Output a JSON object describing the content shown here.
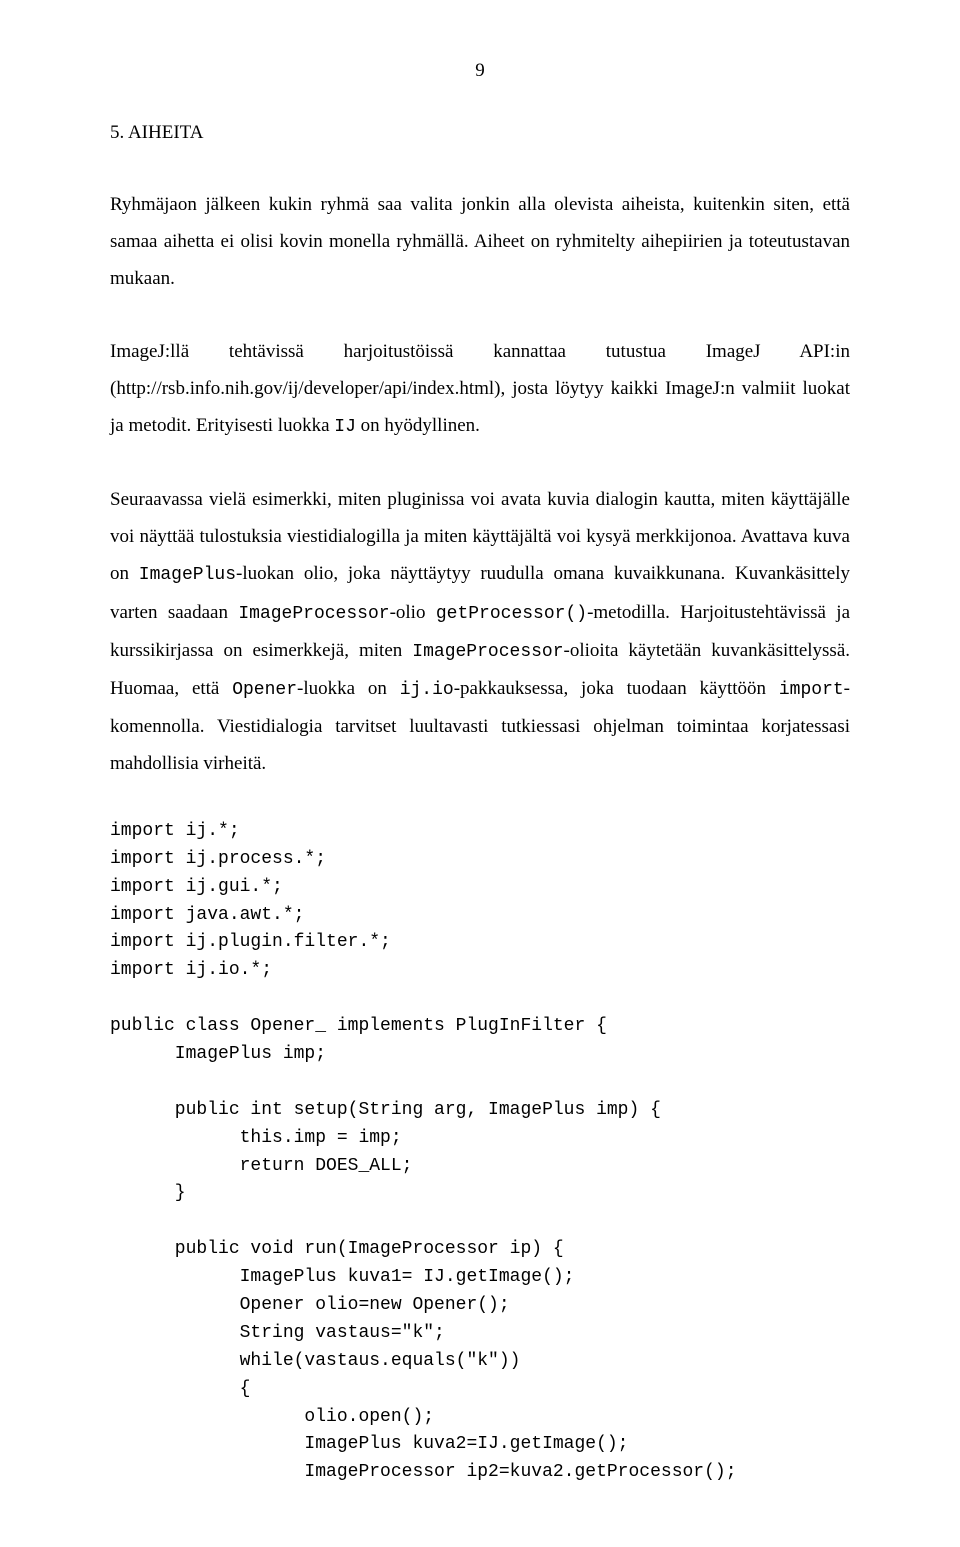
{
  "pageNumber": "9",
  "heading": "5.   AIHEITA",
  "para1_a": "Ryhmäjaon jälkeen kukin ryhmä saa valita jonkin alla olevista aiheista, kuitenkin siten, että samaa aihetta ei olisi kovin monella ryhmällä. Aiheet on ryhmitelty aihepiirien ja toteutustavan mukaan.",
  "para2_a": "ImageJ:llä tehtävissä harjoitustöissä kannattaa tutustua ImageJ API:in (http://rsb.info.nih.gov/ij/developer/api/index.html), josta löytyy kaikki ImageJ:n valmiit luokat ja metodit. Erityisesti luokka ",
  "para2_code1": "IJ",
  "para2_b": " on hyödyllinen.",
  "para3_a": "Seuraavassa vielä esimerkki, miten pluginissa voi avata kuvia dialogin kautta, miten käyttäjälle voi näyttää tulostuksia viestidialogilla ja miten käyttäjältä voi kysyä merkkijonoa. Avattava kuva on ",
  "para3_code1": "ImagePlus",
  "para3_b": "-luokan olio, joka näyttäytyy ruudulla omana kuvaikkunana. Kuvankäsittely varten saadaan ",
  "para3_code2": "ImageProcessor",
  "para3_c": "-olio ",
  "para3_code3": "getProcessor()",
  "para3_d": "-metodilla. Harjoitustehtävissä ja kurssikirjassa on esimerkkejä, miten ",
  "para3_code4": "ImageProcessor",
  "para3_e": "-olioita käytetään kuvankäsittelyssä.  Huomaa, että ",
  "para3_code5": "Opener",
  "para3_f": "-luokka on ",
  "para3_code6": "ij.io",
  "para3_g": "-pakkauksessa, joka tuodaan käyttöön ",
  "para3_code7": "import",
  "para3_h": "-komennolla. Viestidialogia tarvitset luultavasti tutkiessasi ohjelman toimintaa korjatessasi mahdollisia virheitä.",
  "code": "import ij.*;\nimport ij.process.*;\nimport ij.gui.*;\nimport java.awt.*;\nimport ij.plugin.filter.*;\nimport ij.io.*;\n\npublic class Opener_ implements PlugInFilter {\n      ImagePlus imp;\n\n      public int setup(String arg, ImagePlus imp) {\n            this.imp = imp;\n            return DOES_ALL;\n      }\n\n      public void run(ImageProcessor ip) {\n            ImagePlus kuva1= IJ.getImage();\n            Opener olio=new Opener();\n            String vastaus=\"k\";\n            while(vastaus.equals(\"k\"))\n            {\n                  olio.open();\n                  ImagePlus kuva2=IJ.getImage();\n                  ImageProcessor ip2=kuva2.getProcessor();"
}
